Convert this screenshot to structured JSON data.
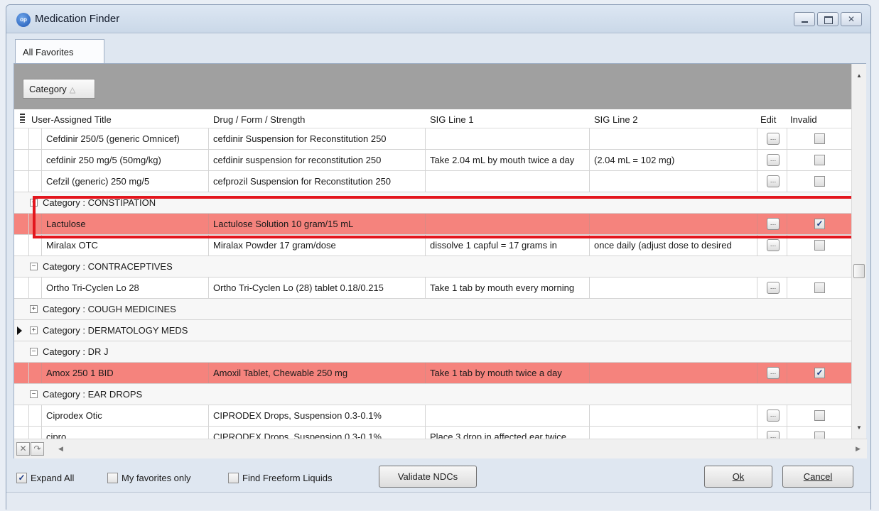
{
  "window": {
    "title": "Medication Finder",
    "app_icon_text": "op"
  },
  "tabs": [
    {
      "label": "All Favorites"
    }
  ],
  "group_panel": {
    "chip_label": "Category"
  },
  "columns": {
    "title": "User-Assigned Title",
    "drug": "Drug / Form / Strength",
    "sig1": "SIG Line 1",
    "sig2": "SIG Line 2",
    "edit": "Edit",
    "invalid": "Invalid"
  },
  "rows": [
    {
      "title": "Cefdinir 250/5 (generic Omnicef)",
      "drug": "cefdinir Suspension for Reconstitution 250",
      "sig1": "",
      "sig2": "",
      "invalid": false
    },
    {
      "title": "cefdinir 250 mg/5 (50mg/kg)",
      "drug": "cefdinir suspension for reconstitution 250",
      "sig1": "Take 2.04 mL by mouth twice a day",
      "sig2": "(2.04 mL = 102 mg)",
      "invalid": false
    },
    {
      "title": "Cefzil (generic) 250 mg/5",
      "drug": "cefprozil Suspension for Reconstitution 250",
      "sig1": "",
      "sig2": "",
      "invalid": false
    },
    {
      "category": "Category : CONSTIPATION",
      "expanded": true
    },
    {
      "title": "Lactulose",
      "drug": "Lactulose Solution 10 gram/15 mL",
      "sig1": "",
      "sig2": "",
      "invalid": true
    },
    {
      "title": "Miralax OTC",
      "drug": "Miralax Powder 17 gram/dose",
      "sig1": "dissolve 1 capful = 17 grams in",
      "sig2": "once daily (adjust dose to desired",
      "invalid": false
    },
    {
      "category": "Category : CONTRACEPTIVES",
      "expanded": true
    },
    {
      "title": "Ortho Tri-Cyclen Lo 28",
      "drug": "Ortho Tri-Cyclen Lo (28) tablet 0.18/0.215",
      "sig1": "Take 1 tab by mouth every morning",
      "sig2": "",
      "invalid": false
    },
    {
      "category": "Category : COUGH MEDICINES",
      "expanded": false
    },
    {
      "category": "Category : DERMATOLOGY MEDS",
      "expanded": false,
      "current": true
    },
    {
      "category": "Category : DR J",
      "expanded": true
    },
    {
      "title": "Amox 250 1 BID",
      "drug": "Amoxil Tablet, Chewable 250 mg",
      "sig1": "Take 1 tab by mouth twice a day",
      "sig2": "",
      "invalid": true
    },
    {
      "category": "Category : EAR DROPS",
      "expanded": true
    },
    {
      "title": "Ciprodex Otic",
      "drug": "CIPRODEX Drops, Suspension 0.3-0.1%",
      "sig1": "",
      "sig2": "",
      "invalid": false
    },
    {
      "title": "cipro",
      "drug": "CIPRODEX Drops, Suspension 0.3-0.1%",
      "sig1": "Place 3 drop in affected ear twice",
      "sig2": "",
      "invalid": false
    }
  ],
  "bottom": {
    "expand_all": {
      "label": "Expand All",
      "checked": true
    },
    "my_favorites": {
      "label": "My favorites only",
      "checked": false
    },
    "freeform": {
      "label": "Find Freeform Liquids",
      "checked": false
    },
    "validate": "Validate NDCs",
    "ok": "Ok",
    "cancel": "Cancel"
  },
  "colors": {
    "invalid_row": "#f5837d",
    "highlight": "#e3161d",
    "group_panel": "#a0a0a0"
  }
}
